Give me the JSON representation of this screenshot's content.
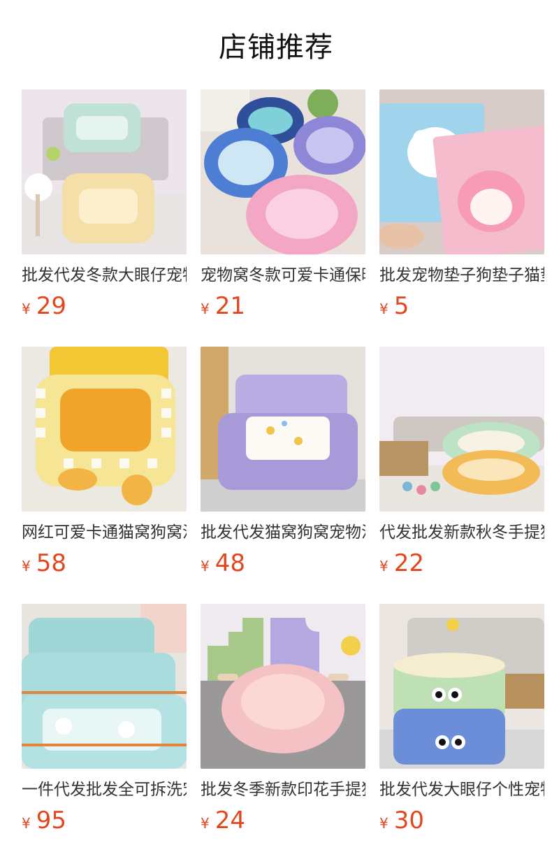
{
  "header": {
    "title": "店铺推荐"
  },
  "currency_symbol": "¥",
  "products": [
    {
      "title": "批发代发冬款大眼仔宠物窝",
      "price": "29",
      "image": "striped-square-pet-beds"
    },
    {
      "title": "宠物窝冬款可爱卡通保暖窝",
      "price": "21",
      "image": "round-cartoon-pet-beds"
    },
    {
      "title": "批发宠物垫子狗垫子猫垫子",
      "price": "5",
      "image": "cartoon-pet-mats"
    },
    {
      "title": "网红可爱卡通猫窝狗窝沙发",
      "price": "58",
      "image": "yellow-checkered-sofa-bed"
    },
    {
      "title": "批发代发猫窝狗窝宠物沙发",
      "price": "48",
      "image": "lilac-gingham-sofa-bed"
    },
    {
      "title": "代发批发新款秋冬手提猫窝",
      "price": "22",
      "image": "plush-round-beds-on-floor"
    },
    {
      "title": "一件代发批发全可拆洗宠物窝",
      "price": "95",
      "image": "blue-gingham-square-beds"
    },
    {
      "title": "批发冬季新款印花手提猫窝",
      "price": "24",
      "image": "pink-round-bed-with-handles"
    },
    {
      "title": "批发代发大眼仔个性宠物窝",
      "price": "30",
      "image": "checkered-eyes-bucket-beds"
    }
  ]
}
